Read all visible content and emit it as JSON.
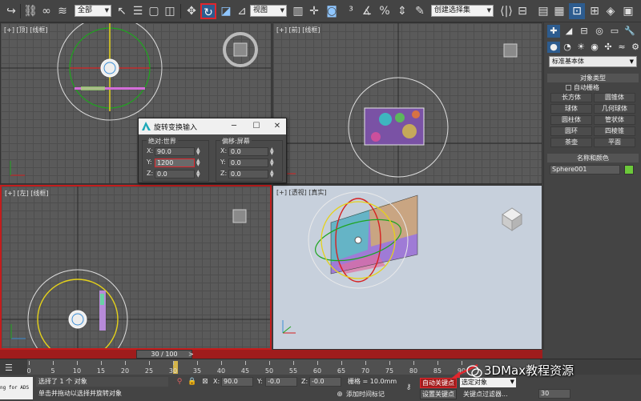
{
  "toolbar": {
    "filter_select": "全部",
    "refcoord_select": "视图",
    "named_selection": "创建选择集"
  },
  "viewports": {
    "top": "[+] [顶] [线框]",
    "front": "[+] [前] [线框]",
    "left": "[+] [左] [线框]",
    "persp": "[+] [透视] [真实]"
  },
  "dialog": {
    "title": "旋转变换输入",
    "absolute_group": "绝对:世界",
    "offset_group": "偏移:屏幕",
    "absolute": {
      "x_label": "X:",
      "x": "90.0",
      "y_label": "Y:",
      "y": "1200",
      "z_label": "Z:",
      "z": "0.0"
    },
    "offset": {
      "x_label": "X:",
      "x": "0.0",
      "y_label": "Y:",
      "y": "0.0",
      "z_label": "Z:",
      "z": "0.0"
    }
  },
  "command_panel": {
    "dropdown": "标准基本体",
    "rollout_object_type": "对象类型",
    "autogrid": "自动栅格",
    "primitives": [
      "长方体",
      "圆锥体",
      "球体",
      "几何球体",
      "圆柱体",
      "管状体",
      "圆环",
      "四棱锥",
      "茶壶",
      "平面"
    ],
    "rollout_name_color": "名称和颜色",
    "object_name": "Sphere001",
    "object_color": "#6cc93a"
  },
  "time": {
    "slider_label": "30 / 100",
    "ticks": [
      "0",
      "5",
      "10",
      "15",
      "20",
      "25",
      "30",
      "35",
      "40",
      "45",
      "50",
      "55",
      "60",
      "65",
      "70",
      "75",
      "80",
      "85",
      "90"
    ]
  },
  "status": {
    "maxscript": "ng for ADS",
    "selection": "选择了 1 个 对象",
    "prompt": "单击并拖动以选择并旋转对象",
    "x_label": "X:",
    "x": "90.0",
    "y_label": "Y:",
    "y": "-0.0",
    "z_label": "Z:",
    "z": "-0.0",
    "grid": "栅格 = 10.0mm",
    "add_time_tag": "添加时间标记",
    "autokey": "自动关键点",
    "setkey": "设置关键点",
    "select_object": "选定对象",
    "key_filters": "关键点过滤器...",
    "frame": "30"
  },
  "watermark": "3DMax教程资源"
}
